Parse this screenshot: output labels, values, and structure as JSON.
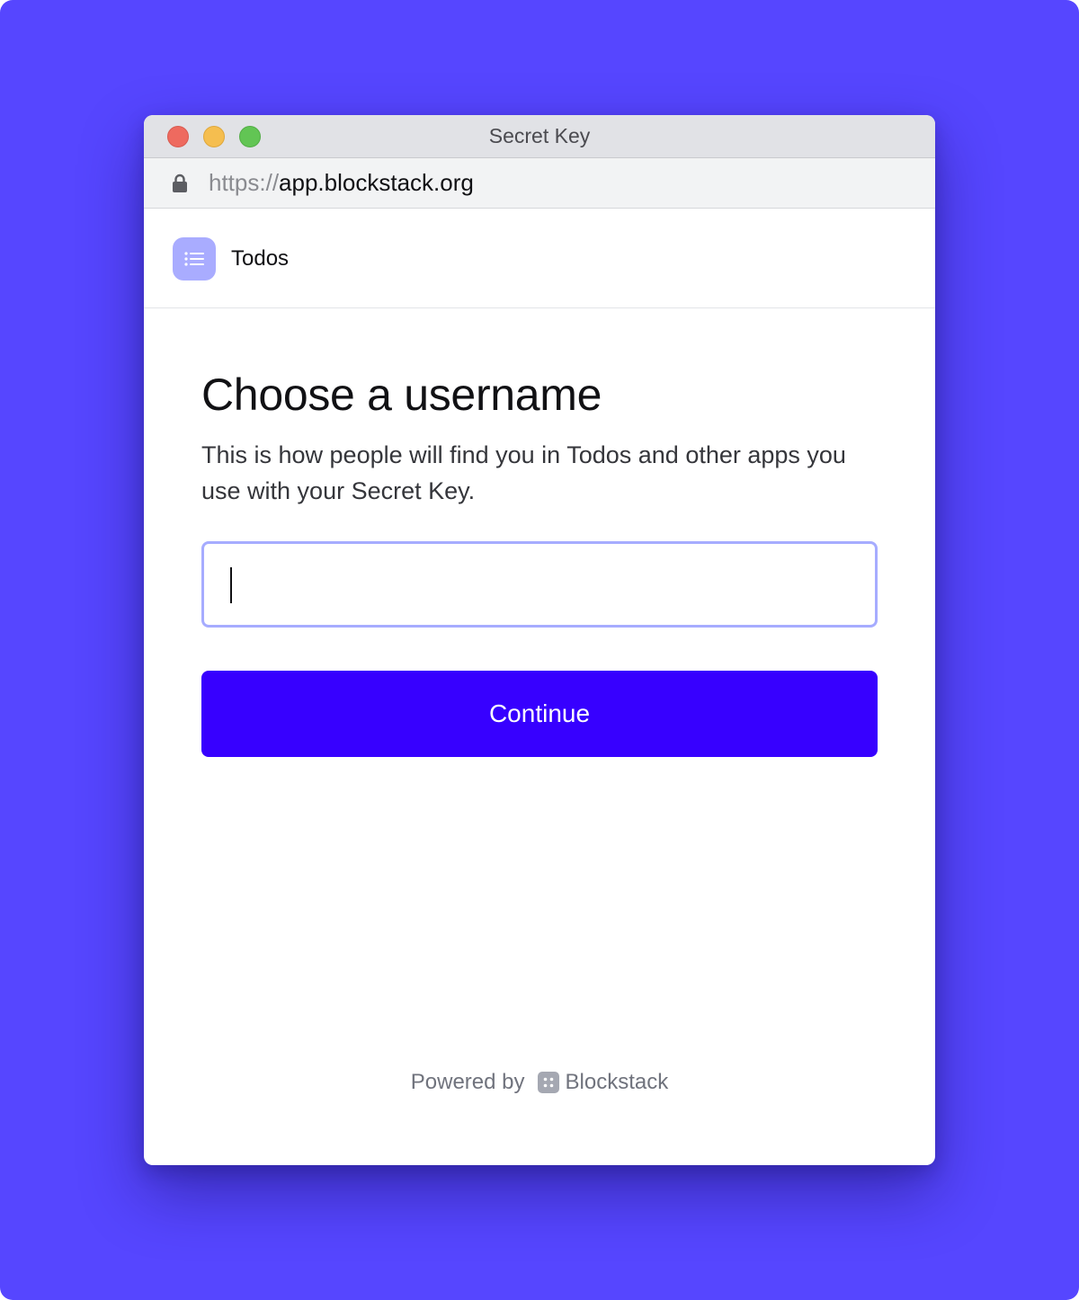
{
  "window": {
    "title": "Secret Key",
    "url_scheme": "https://",
    "url_host": "app.blockstack.org"
  },
  "app": {
    "name": "Todos",
    "icon": "list-icon"
  },
  "main": {
    "heading": "Choose a username",
    "description": "This is how people will find you in Todos and other apps you use with your Secret Key.",
    "username_value": "",
    "continue_label": "Continue"
  },
  "footer": {
    "powered_by": "Powered by",
    "brand": "Blockstack",
    "brand_icon": "blockstack-icon"
  },
  "colors": {
    "background": "#5646ff",
    "accent": "#3700ff",
    "input_focus_border": "#a6acff",
    "app_icon_bg": "#a9acff"
  }
}
